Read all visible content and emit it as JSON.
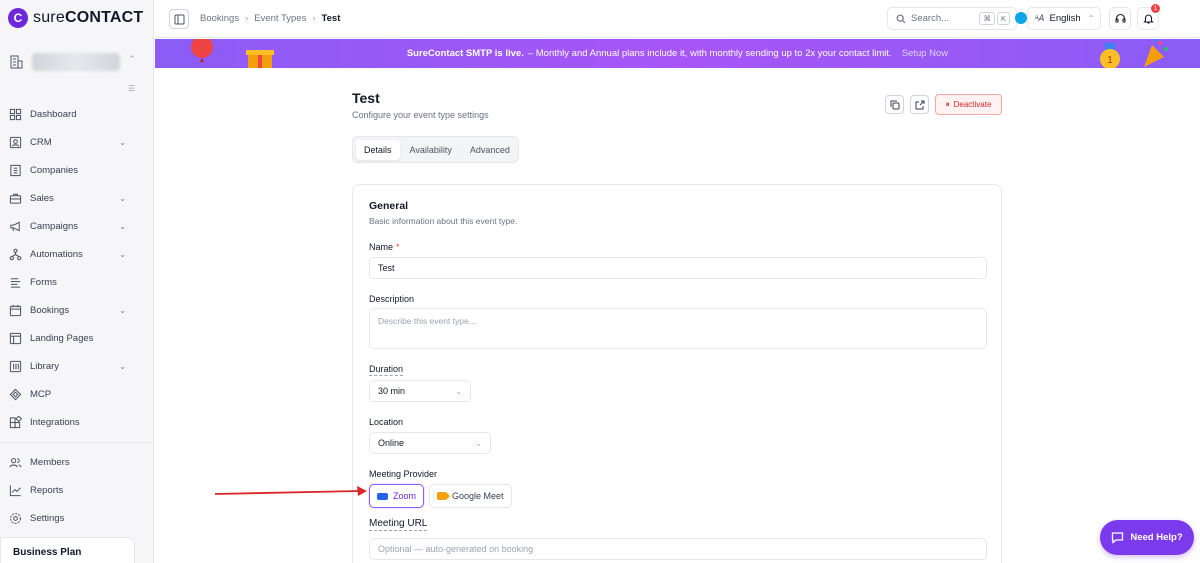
{
  "brand": {
    "name_prefix": "sure",
    "name_suffix": "CONTACT"
  },
  "sidebar": {
    "items": [
      {
        "label": "Dashboard",
        "icon": "dashboard-icon",
        "chevron": false
      },
      {
        "label": "CRM",
        "icon": "crm-icon",
        "chevron": true
      },
      {
        "label": "Companies",
        "icon": "building-icon",
        "chevron": false
      },
      {
        "label": "Sales",
        "icon": "briefcase-icon",
        "chevron": true
      },
      {
        "label": "Campaigns",
        "icon": "megaphone-icon",
        "chevron": true
      },
      {
        "label": "Automations",
        "icon": "workflow-icon",
        "chevron": true
      },
      {
        "label": "Forms",
        "icon": "form-icon",
        "chevron": false
      },
      {
        "label": "Bookings",
        "icon": "calendar-icon",
        "chevron": true
      },
      {
        "label": "Landing Pages",
        "icon": "page-icon",
        "chevron": false
      },
      {
        "label": "Library",
        "icon": "library-icon",
        "chevron": true
      },
      {
        "label": "MCP",
        "icon": "mcp-icon",
        "chevron": false
      },
      {
        "label": "Integrations",
        "icon": "integrations-icon",
        "chevron": false
      }
    ],
    "bottom_items": [
      {
        "label": "Members",
        "icon": "members-icon"
      },
      {
        "label": "Reports",
        "icon": "reports-icon"
      },
      {
        "label": "Settings",
        "icon": "settings-icon"
      }
    ],
    "plan": "Business Plan"
  },
  "header": {
    "breadcrumb": [
      "Bookings",
      "Event Types",
      "Test"
    ],
    "search_placeholder": "Search...",
    "search_kbd": [
      "⌘",
      "K"
    ],
    "language": "English",
    "notification_count": "1"
  },
  "banner": {
    "strong": "SureContact SMTP is live.",
    "text": "– Monthly and Annual plans include it, with monthly sending up to 2x your contact limit.",
    "link": "Setup Now"
  },
  "page": {
    "title": "Test",
    "subtitle": "Configure your event type settings",
    "deactivate": "Deactivate",
    "tabs": [
      "Details",
      "Availability",
      "Advanced"
    ],
    "active_tab": "Details"
  },
  "form": {
    "section_title": "General",
    "section_subtitle": "Basic information about this event type.",
    "name_label": "Name",
    "name_required": "*",
    "name_value": "Test",
    "description_label": "Description",
    "description_placeholder": "Describe this event type...",
    "duration_label": "Duration",
    "duration_value": "30 min",
    "location_label": "Location",
    "location_value": "Online",
    "provider_label": "Meeting Provider",
    "providers": [
      "Zoom",
      "Google Meet"
    ],
    "selected_provider": "Zoom",
    "url_label": "Meeting URL",
    "url_placeholder": "Optional — auto-generated on booking"
  },
  "help_button": "Need Help?",
  "colors": {
    "accent": "#7c3aed",
    "banner": "#a855f7",
    "danger": "#dc2626",
    "arrow": "#dc2626"
  }
}
